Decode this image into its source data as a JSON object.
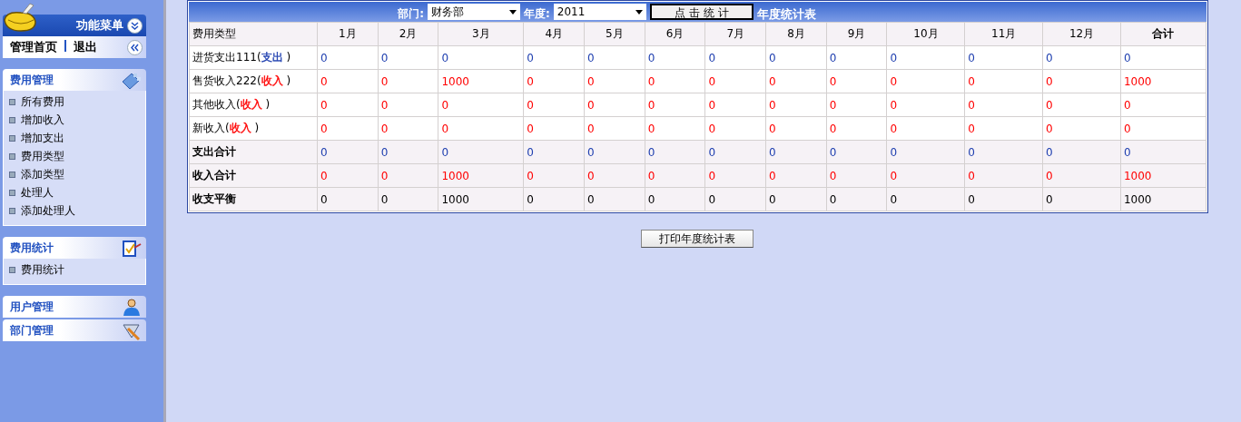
{
  "sidebar": {
    "title": "功能菜单",
    "top_links": [
      "管理首页",
      "退出"
    ],
    "sections": [
      {
        "title": "费用管理",
        "items": [
          "所有费用",
          "增加收入",
          "增加支出",
          "费用类型",
          "添加类型",
          "处理人",
          "添加处理人"
        ]
      },
      {
        "title": "费用统计",
        "items": [
          "费用统计"
        ]
      },
      {
        "title": "用户管理"
      },
      {
        "title": "部门管理"
      }
    ]
  },
  "toolbar": {
    "department_label": "部门:",
    "department": "财务部",
    "year_label": "年度:",
    "year": "2011",
    "submit": "点 击 统 计",
    "title": "年度统计表"
  },
  "table": {
    "columns": [
      "费用类型",
      "1月",
      "2月",
      "3月",
      "4月",
      "5月",
      "6月",
      "7月",
      "8月",
      "9月",
      "10月",
      "11月",
      "12月",
      "合计"
    ],
    "rows": [
      {
        "kind": "type",
        "label": [
          {
            "text": "进货支出111("
          },
          {
            "text": "支出",
            "color": "#2040b0"
          },
          {
            "text": " )"
          }
        ],
        "color": "#2040b0",
        "values": [
          "0",
          "0",
          "0",
          "0",
          "0",
          "0",
          "0",
          "0",
          "0",
          "0",
          "0",
          "0",
          "0"
        ]
      },
      {
        "kind": "type",
        "label": [
          {
            "text": "售货收入222("
          },
          {
            "text": "收入",
            "color": "#ff0000"
          },
          {
            "text": " )"
          }
        ],
        "color": "#ff0000",
        "values": [
          "0",
          "0",
          "1000",
          "0",
          "0",
          "0",
          "0",
          "0",
          "0",
          "0",
          "0",
          "0",
          "1000"
        ]
      },
      {
        "kind": "type",
        "label": [
          {
            "text": "其他收入("
          },
          {
            "text": "收入",
            "color": "#ff0000"
          },
          {
            "text": " )"
          }
        ],
        "color": "#ff0000",
        "values": [
          "0",
          "0",
          "0",
          "0",
          "0",
          "0",
          "0",
          "0",
          "0",
          "0",
          "0",
          "0",
          "0"
        ]
      },
      {
        "kind": "type",
        "label": [
          {
            "text": "新收入("
          },
          {
            "text": "收入",
            "color": "#ff0000"
          },
          {
            "text": " )"
          }
        ],
        "color": "#ff0000",
        "values": [
          "0",
          "0",
          "0",
          "0",
          "0",
          "0",
          "0",
          "0",
          "0",
          "0",
          "0",
          "0",
          "0"
        ]
      },
      {
        "kind": "total",
        "label": [
          {
            "text": "支出合计"
          }
        ],
        "color": "#2040b0",
        "values": [
          "0",
          "0",
          "0",
          "0",
          "0",
          "0",
          "0",
          "0",
          "0",
          "0",
          "0",
          "0",
          "0"
        ]
      },
      {
        "kind": "total",
        "label": [
          {
            "text": "收入合计"
          }
        ],
        "color": "#ff0000",
        "values": [
          "0",
          "0",
          "1000",
          "0",
          "0",
          "0",
          "0",
          "0",
          "0",
          "0",
          "0",
          "0",
          "1000"
        ]
      },
      {
        "kind": "total",
        "label": [
          {
            "text": "收支平衡"
          }
        ],
        "color": "#000000",
        "values": [
          "0",
          "0",
          "1000",
          "0",
          "0",
          "0",
          "0",
          "0",
          "0",
          "0",
          "0",
          "0",
          "1000"
        ]
      }
    ]
  },
  "print_button": "打印年度统计表"
}
